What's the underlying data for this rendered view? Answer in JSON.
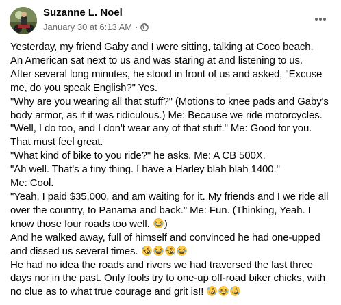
{
  "post": {
    "author": "Suzanne L. Noel",
    "timestamp": "January 30 at 6:13 AM",
    "separator": "·",
    "audience_icon": "globe-icon",
    "more_icon": "more-options-icon",
    "lines": [
      "Yesterday, my friend Gaby and I were sitting, talking at  Coco beach.",
      "An American sat next to us and was staring at and listening to us.",
      "After several long minutes, he stood in front of us and asked, \"Excuse",
      "me, do you speak English?\" Yes.",
      "\"Why are you wearing all that stuff?\" (Motions to knee pads and Gaby's",
      "body armor, as if it was ridiculous.) Me: Because we ride motorcycles.",
      "\"Well, I do too, and I don't wear any of that stuff.\" Me: Good for you.",
      "That must feel great.",
      "\"What kind of bike to you ride?\" he asks. Me: A CB 500X.",
      "\"Ah well. That's a tiny thing. I have a Harley blah blah 1400.\"",
      "Me: Cool.",
      "\"Yeah, I paid $35,000, and am waiting for it. My friends and I we ride all",
      "over the country, to Panama and back.\" Me: Fun. (Thinking, Yeah. I",
      "know those four roads too well.",
      ")",
      "And he walked away, full of himself and convinced he had one-upped",
      "and dissed us several times.",
      "He had no idea the roads and rivers we had traversed the last three",
      "days nor in the past. Only fools try to one-up off-road biker chicks, with",
      "no clue as to what true courage and grit is!!"
    ],
    "emoji": {
      "laughing": "grinning-squinting-face-emoji",
      "rofl": "rolling-on-the-floor-laughing-emoji"
    },
    "colors": {
      "text": "#050505",
      "secondary": "#65676b",
      "emoji_face": "#ffcc4d",
      "emoji_outline": "#e8a200"
    }
  }
}
